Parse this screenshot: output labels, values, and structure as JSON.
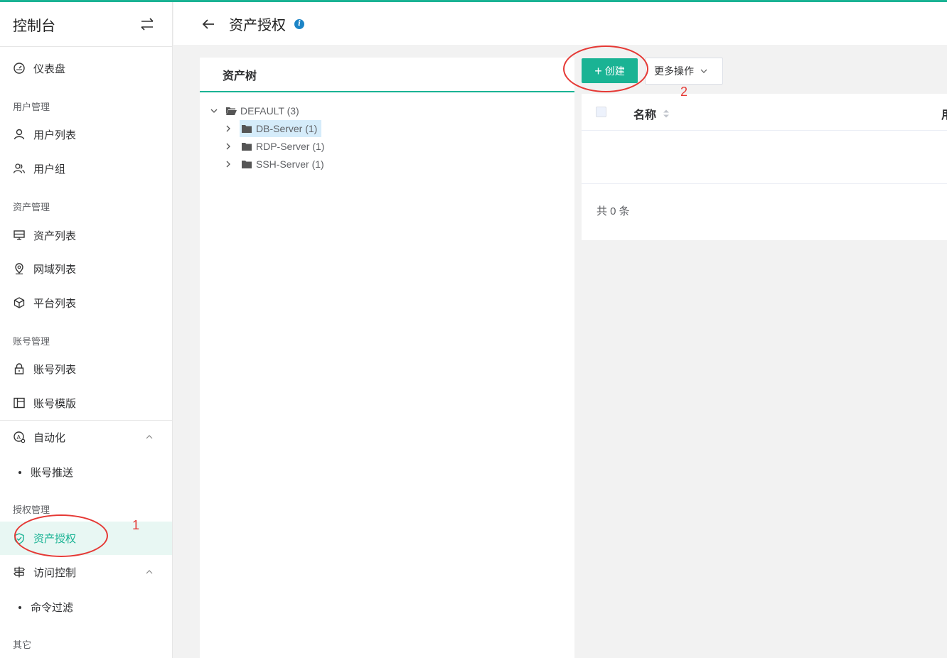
{
  "app": {
    "title": "控制台"
  },
  "header": {
    "title": "资产授权"
  },
  "sidebar": {
    "dashboard": "仪表盘",
    "groups": {
      "user": "用户管理",
      "asset": "资产管理",
      "account": "账号管理",
      "perm": "授权管理",
      "other": "其它"
    },
    "items": {
      "user_list": "用户列表",
      "user_group": "用户组",
      "asset_list": "资产列表",
      "domain_list": "网域列表",
      "platform_list": "平台列表",
      "account_list": "账号列表",
      "account_template": "账号模版",
      "automation": "自动化",
      "account_push": "账号推送",
      "asset_perm": "资产授权",
      "access_control": "访问控制",
      "cmd_filter": "命令过滤"
    }
  },
  "tree": {
    "title": "资产树",
    "root": "DEFAULT (3)",
    "children": [
      "DB-Server (1)",
      "RDP-Server (1)",
      "SSH-Server (1)"
    ]
  },
  "toolbar": {
    "create": "创建",
    "more": "更多操作"
  },
  "table": {
    "col_name": "名称",
    "col_cut": "用",
    "total": "共 0 条"
  },
  "annotations": {
    "one": "1",
    "two": "2"
  },
  "colors": {
    "accent": "#1ab394",
    "annotation": "#e53935",
    "selected": "#d5ecfa"
  }
}
